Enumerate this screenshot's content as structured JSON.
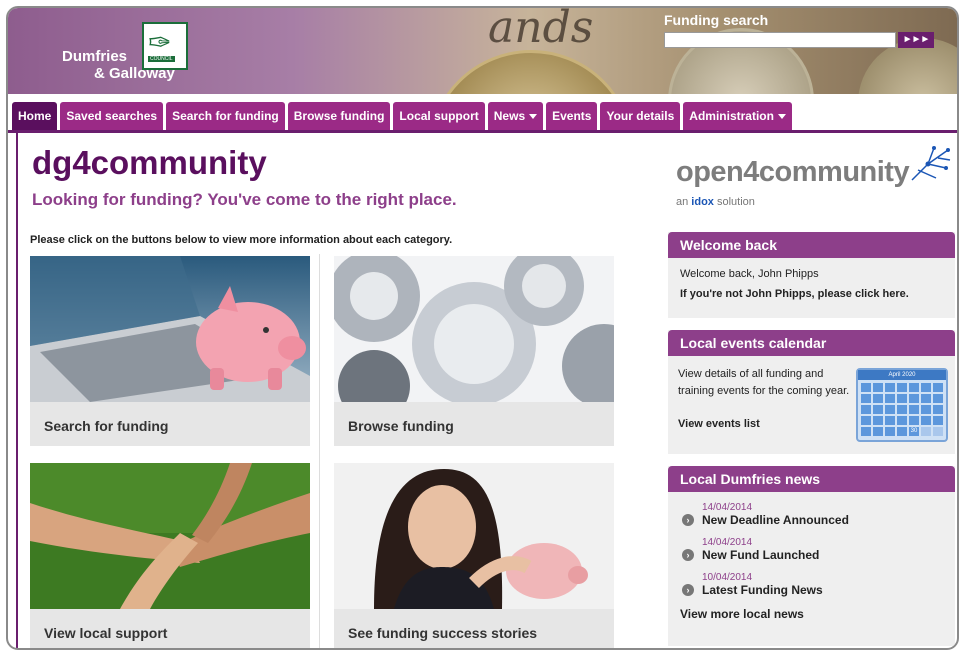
{
  "header": {
    "org_line1": "Dumfries",
    "org_line2": "& Galloway",
    "logo_caption": "COUNCIL",
    "search": {
      "title": "Funding search",
      "value": "",
      "button": "►►►"
    }
  },
  "nav": {
    "tabs": [
      {
        "label": "Home",
        "active": true
      },
      {
        "label": "Saved searches"
      },
      {
        "label": "Search for funding"
      },
      {
        "label": "Browse funding"
      },
      {
        "label": "Local support"
      },
      {
        "label": "News",
        "dropdown": true
      },
      {
        "label": "Events"
      },
      {
        "label": "Your details"
      },
      {
        "label": "Administration",
        "dropdown": true
      }
    ]
  },
  "main": {
    "title": "dg4community",
    "subtitle": "Looking for funding? You've come to the right place.",
    "intro": "Please click on the buttons below to view more information about each category.",
    "cards": [
      {
        "label": "Search for funding",
        "icon": "piggy-bank-laptop"
      },
      {
        "label": "Browse funding",
        "icon": "gears"
      },
      {
        "label": "View local support",
        "icon": "linked-hands"
      },
      {
        "label": "See funding success stories",
        "icon": "woman-piggy-bank"
      }
    ]
  },
  "sidebar": {
    "brand": {
      "name": "open4community",
      "tagline_prefix": "an ",
      "tagline_brand": "idox",
      "tagline_suffix": " solution"
    },
    "welcome": {
      "title": "Welcome back",
      "line1": "Welcome back, John Phipps",
      "line2": "If you're not John Phipps, please click here."
    },
    "events": {
      "title": "Local events calendar",
      "text": "View details of all funding and training events for the coming year.",
      "link": "View events list",
      "calendar_month": "April 2020",
      "calendar_day": "30"
    },
    "news": {
      "title": "Local Dumfries news",
      "items": [
        {
          "date": "14/04/2014",
          "title": "New Deadline Announced"
        },
        {
          "date": "14/04/2014",
          "title": "New Fund Launched"
        },
        {
          "date": "10/04/2014",
          "title": "Latest Funding News"
        }
      ],
      "more": "View more local news"
    }
  },
  "colors": {
    "primary": "#5a0f5e",
    "tab": "#9b2a86",
    "panel_header": "#8d3f8a"
  }
}
